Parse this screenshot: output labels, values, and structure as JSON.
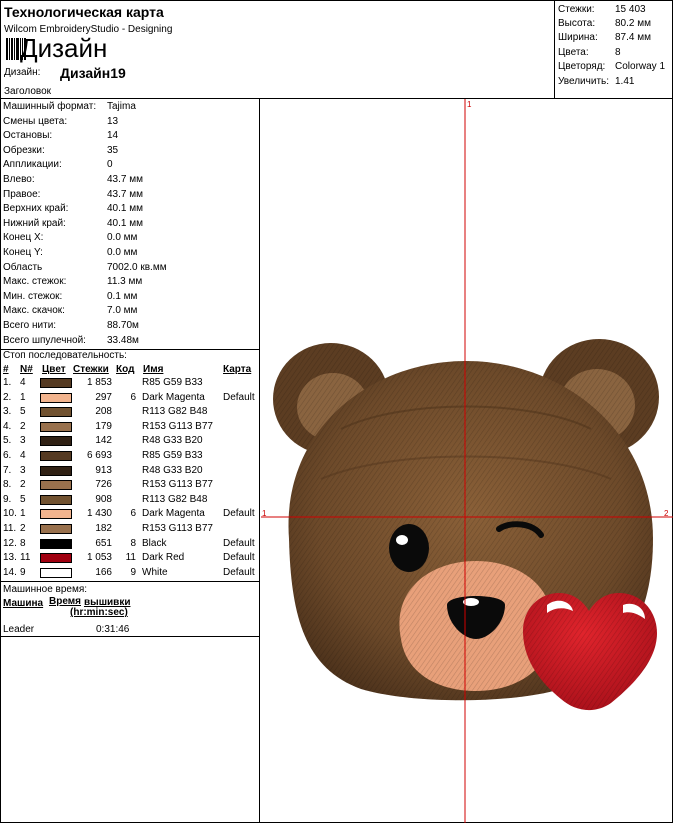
{
  "header": {
    "title": "Технологическая карта",
    "software": "Wilcom EmbroideryStudio - Designing",
    "design_big": "Дизайн",
    "design_label": "Дизайн:",
    "design_name": "Дизайн19",
    "heading_label": "Заголовок"
  },
  "stats": [
    {
      "label": "Стежки:",
      "value": "15 403"
    },
    {
      "label": "Высота:",
      "value": "80.2 мм"
    },
    {
      "label": "Ширина:",
      "value": "87.4 мм"
    },
    {
      "label": "Цвета:",
      "value": "8"
    },
    {
      "label": "Цветоряд:",
      "value": "Colorway 1"
    },
    {
      "label": "Увеличить:",
      "value": "1.41"
    }
  ],
  "info": [
    {
      "label": "Машинный формат:",
      "value": "Tajima"
    },
    {
      "label": "Смены цвета:",
      "value": "13"
    },
    {
      "label": "Остановы:",
      "value": "14"
    },
    {
      "label": "Обрезки:",
      "value": "35"
    },
    {
      "label": "Аппликации:",
      "value": "0"
    },
    {
      "label": "Влево:",
      "value": "43.7 мм"
    },
    {
      "label": "Правое:",
      "value": "43.7 мм"
    },
    {
      "label": "Верхних край:",
      "value": "40.1 мм"
    },
    {
      "label": "Нижний край:",
      "value": "40.1 мм"
    },
    {
      "label": "Конец X:",
      "value": "0.0 мм"
    },
    {
      "label": "Конец Y:",
      "value": "0.0 мм"
    },
    {
      "label": "Область",
      "value": "7002.0 кв.мм"
    },
    {
      "label": "Макс. стежок:",
      "value": "11.3 мм"
    },
    {
      "label": "Мин. стежок:",
      "value": "0.1 мм"
    },
    {
      "label": "Макс. скачок:",
      "value": "7.0 мм"
    },
    {
      "label": "Всего нити:",
      "value": "88.70м"
    },
    {
      "label": "Всего шпулечной:",
      "value": "33.48м"
    }
  ],
  "stop_sequence": {
    "title": "Стоп последовательность:",
    "headers": {
      "num": "#",
      "n": "N#",
      "color": "Цвет",
      "stitches": "Стежки",
      "code": "Код",
      "name": "Имя",
      "chart": "Карта"
    },
    "rows": [
      {
        "num": "1.",
        "n": "4",
        "swatch": "#553a22",
        "stitches": "1 853",
        "code": "",
        "name": "R85 G59 B33",
        "chart": ""
      },
      {
        "num": "2.",
        "n": "1",
        "swatch": "#f2b48e",
        "stitches": "297",
        "code": "6",
        "name": "Dark Magenta",
        "chart": "Default"
      },
      {
        "num": "3.",
        "n": "5",
        "swatch": "#715230",
        "stitches": "208",
        "code": "",
        "name": "R113 G82 B48",
        "chart": ""
      },
      {
        "num": "4.",
        "n": "2",
        "swatch": "#99714d",
        "stitches": "179",
        "code": "",
        "name": "R153 G113 B77",
        "chart": ""
      },
      {
        "num": "5.",
        "n": "3",
        "swatch": "#302114",
        "stitches": "142",
        "code": "",
        "name": "R48 G33 B20",
        "chart": ""
      },
      {
        "num": "6.",
        "n": "4",
        "swatch": "#553a22",
        "stitches": "6 693",
        "code": "",
        "name": "R85 G59 B33",
        "chart": ""
      },
      {
        "num": "7.",
        "n": "3",
        "swatch": "#302114",
        "stitches": "913",
        "code": "",
        "name": "R48 G33 B20",
        "chart": ""
      },
      {
        "num": "8.",
        "n": "2",
        "swatch": "#99714d",
        "stitches": "726",
        "code": "",
        "name": "R153 G113 B77",
        "chart": ""
      },
      {
        "num": "9.",
        "n": "5",
        "swatch": "#715230",
        "stitches": "908",
        "code": "",
        "name": "R113 G82 B48",
        "chart": ""
      },
      {
        "num": "10.",
        "n": "1",
        "swatch": "#f2b48e",
        "stitches": "1 430",
        "code": "6",
        "name": "Dark Magenta",
        "chart": "Default"
      },
      {
        "num": "11.",
        "n": "2",
        "swatch": "#99714d",
        "stitches": "182",
        "code": "",
        "name": "R153 G113 B77",
        "chart": ""
      },
      {
        "num": "12.",
        "n": "8",
        "swatch": "#000000",
        "stitches": "651",
        "code": "8",
        "name": "Black",
        "chart": "Default"
      },
      {
        "num": "13.",
        "n": "11",
        "swatch": "#a00010",
        "stitches": "1 053",
        "code": "11",
        "name": "Dark Red",
        "chart": "Default"
      },
      {
        "num": "14.",
        "n": "9",
        "swatch": "#ffffff",
        "stitches": "166",
        "code": "9",
        "name": "White",
        "chart": "Default"
      }
    ]
  },
  "machine_time": {
    "title": "Машинное время:",
    "col_machine": "Машина",
    "col_time_1": "Время",
    "col_time_2": "вышивки",
    "col_time_3": "(hr:min:sec)",
    "row": {
      "machine": "Leader",
      "time": "0:31:46"
    }
  },
  "preview": {
    "axis_labels": {
      "top": "1",
      "left": "1",
      "right": "2"
    }
  }
}
